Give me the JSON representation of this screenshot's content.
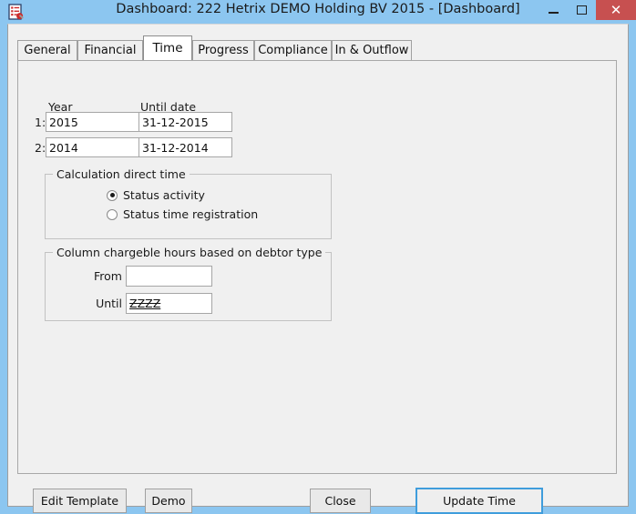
{
  "window": {
    "title": "Dashboard: 222 Hetrix DEMO Holding BV 2015 - [Dashboard]",
    "icon": "document-list-icon",
    "controls": {
      "minimize": "–",
      "maximize": "□",
      "close": "✕"
    },
    "colors": {
      "frame": "#8cc6f0",
      "dialog": "#f0f0f0",
      "close_button": "#c75050",
      "focus_border": "#3f9ddc"
    }
  },
  "tabs": [
    {
      "label": "General",
      "active": false
    },
    {
      "label": "Financial",
      "active": false
    },
    {
      "label": "Time",
      "active": true
    },
    {
      "label": "Progress",
      "active": false
    },
    {
      "label": "Compliance",
      "active": false
    },
    {
      "label": "In & Outflow",
      "active": false
    }
  ],
  "time_tab": {
    "headers": {
      "year": "Year",
      "until_date": "Until date"
    },
    "rows": [
      {
        "num": "1:",
        "year": "2015",
        "until_date": "31-12-2015"
      },
      {
        "num": "2:",
        "year": "2014",
        "until_date": "31-12-2014"
      }
    ],
    "calculation_group": {
      "title": "Calculation direct time",
      "options": [
        {
          "label": "Status activity",
          "selected": true
        },
        {
          "label": "Status time registration",
          "selected": false
        }
      ]
    },
    "column_group": {
      "title": "Column chargeble hours based on debtor type",
      "from_label": "From",
      "from_value": "",
      "until_label": "Until",
      "until_value": "ZZZZ"
    }
  },
  "footer": {
    "edit_template": "Edit Template",
    "demo": "Demo",
    "close": "Close",
    "update_time": "Update Time"
  }
}
